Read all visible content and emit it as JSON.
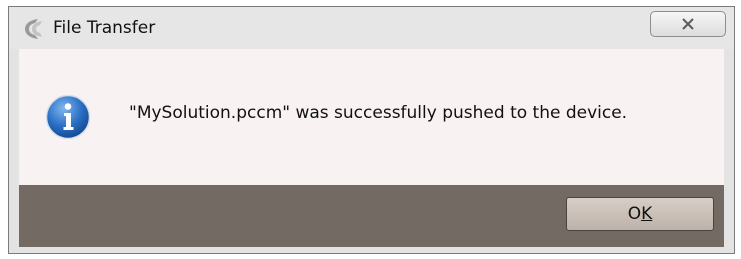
{
  "window": {
    "title": "File Transfer",
    "close_icon": "close-icon",
    "app_icon": "app-logo-icon"
  },
  "dialog": {
    "icon": "info-icon",
    "message": "\"MySolution.pccm\" was successfully pushed to the device."
  },
  "buttons": {
    "ok_label_prefix": "O",
    "ok_label_access_key": "K"
  },
  "colors": {
    "content_bg": "#f8f2f2",
    "footer_bg": "#726a63",
    "info_blue": "#1f63b8"
  }
}
